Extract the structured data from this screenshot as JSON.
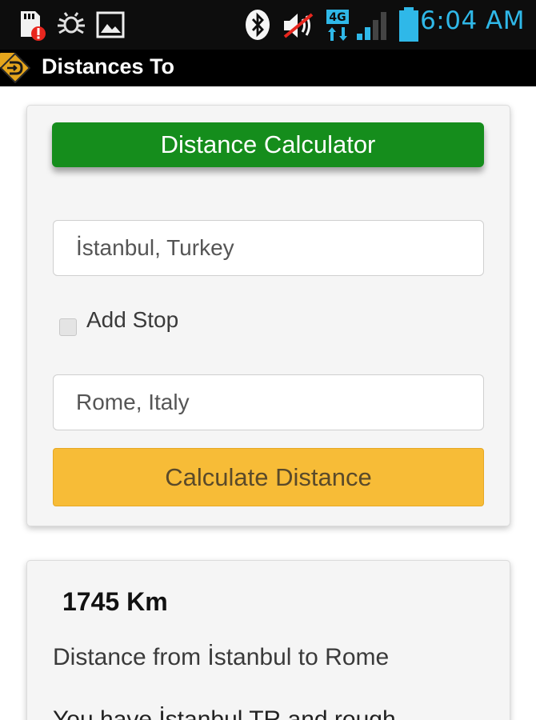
{
  "status_bar": {
    "time": "6:04 AM",
    "network_label": "4G",
    "icons": [
      "sd-card-alert-icon",
      "usb-debug-icon",
      "picture-icon",
      "bluetooth-icon",
      "mute-icon",
      "network-4g-icon",
      "signal-icon",
      "battery-icon"
    ]
  },
  "app_bar": {
    "title": "Distances To",
    "logo_icon": "app-logo-icon"
  },
  "calculator": {
    "header": "Distance Calculator",
    "from_value": "İstanbul, Turkey",
    "add_stop_label": "Add Stop",
    "add_stop_checked": false,
    "to_value": "Rome, Italy",
    "button_label": "Calculate Distance"
  },
  "result": {
    "distance": "1745 Km",
    "description": "Distance from İstanbul to Rome",
    "more_text": "You have İstanbul TR and rough"
  },
  "colors": {
    "status_time": "#2fb8e8",
    "header_green": "#158d1c",
    "button_yellow": "#f7bc37",
    "action_bar": "#000000"
  }
}
